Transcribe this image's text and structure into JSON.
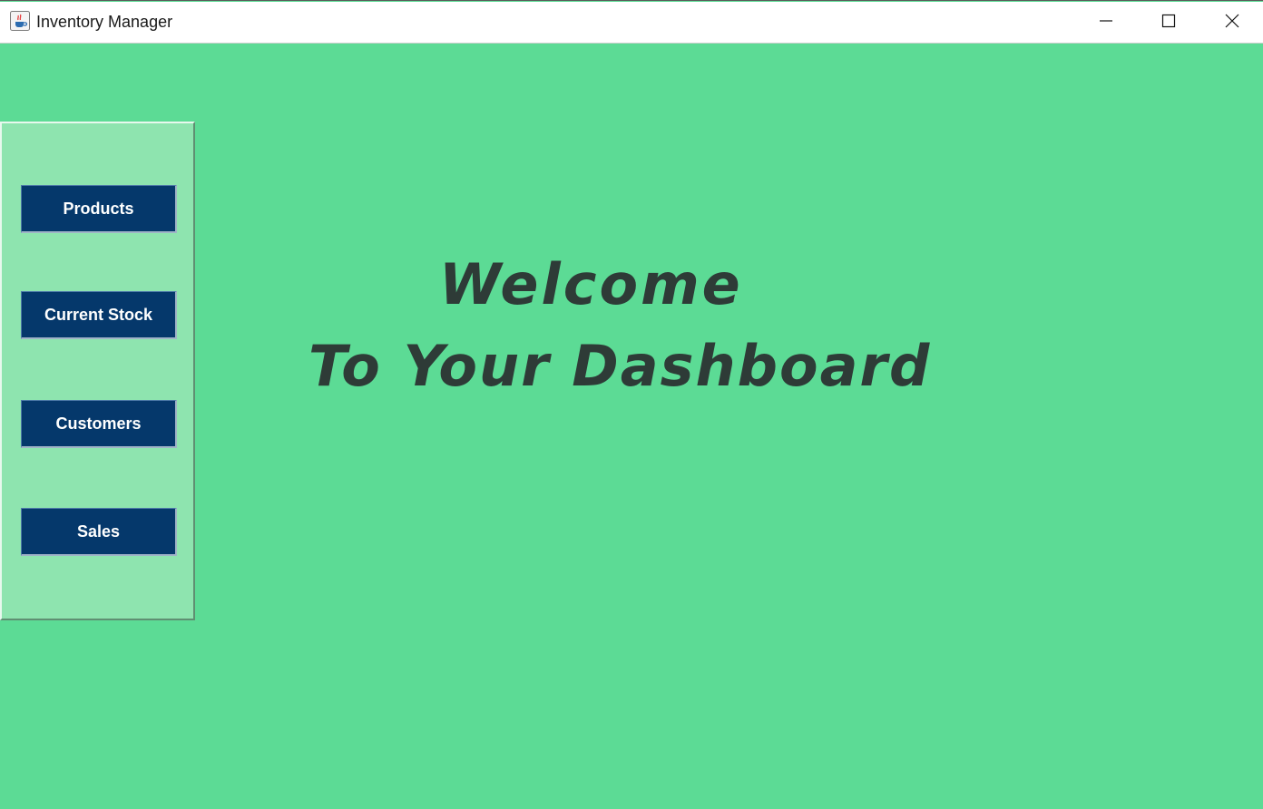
{
  "window": {
    "title": "Inventory Manager",
    "icon": "java-cup-icon",
    "controls": [
      "minimize-icon",
      "maximize-icon",
      "close-icon"
    ]
  },
  "sidebar": {
    "items": [
      {
        "label": "Products"
      },
      {
        "label": "Current Stock"
      },
      {
        "label": "Customers"
      },
      {
        "label": "Sales"
      }
    ]
  },
  "main": {
    "heading_line1": "Welcome",
    "heading_line2": "To Your Dashboard"
  },
  "colors": {
    "background": "#5cdb95",
    "sidebar": "#8ee4af",
    "button": "#05386b",
    "button_text": "#ffffff",
    "heading_text": "#2e3b37"
  }
}
